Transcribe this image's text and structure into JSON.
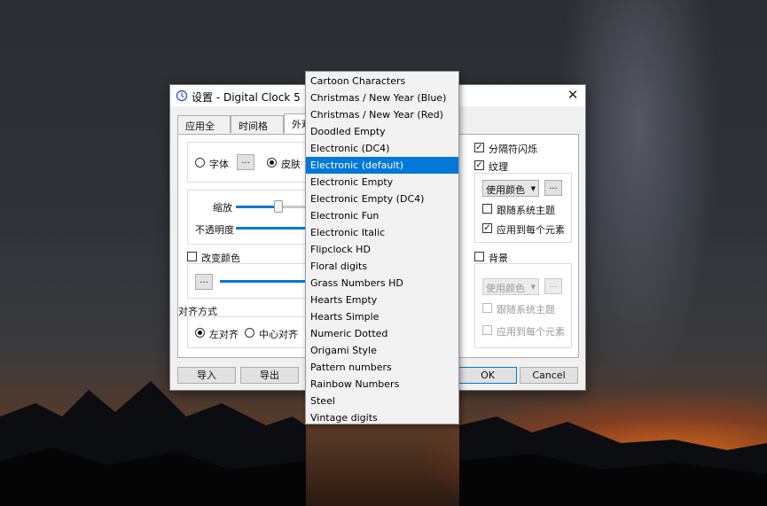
{
  "dialog": {
    "title": "设置 - Digital Clock 5",
    "tabs": [
      "应用全局",
      "时间格式",
      "外观"
    ],
    "font_label": "字体",
    "skin_label": "皮肤",
    "zoom_label": "缩放",
    "opacity_label": "不透明度",
    "change_color_label": "改变颜色",
    "align_label": "对齐方式",
    "align_left": "左对齐",
    "align_center": "中心对齐",
    "separator_blink": "分隔符闪烁",
    "texture": "纹理",
    "texture_combo": "使用颜色",
    "follow_theme": "跟随系统主题",
    "apply_each": "应用到每个元素",
    "background": "背景",
    "bg_combo": "使用颜色",
    "bg_follow_theme": "跟随系统主题",
    "bg_apply_each": "应用到每个元素",
    "import_btn": "导入",
    "export_btn": "导出",
    "ok_btn": "OK",
    "cancel_btn": "Cancel",
    "ellipsis": "..."
  },
  "skins": {
    "items": [
      "Cartoon Characters",
      "Christmas / New Year (Blue)",
      "Christmas / New Year (Red)",
      "Doodled Empty",
      "Electronic (DC4)",
      "Electronic (default)",
      "Electronic Empty",
      "Electronic Empty (DC4)",
      "Electronic Fun",
      "Electronic Italic",
      "Flipclock HD",
      "Floral digits",
      "Grass Numbers HD",
      "Hearts Empty",
      "Hearts Simple",
      "Numeric Dotted",
      "Origami Style",
      "Pattern numbers",
      "Rainbow Numbers",
      "Steel",
      "Vintage digits"
    ],
    "selected": "Electronic (default)"
  },
  "accent_color": "#0078d7",
  "checks": {
    "separator_blink": true,
    "texture": true,
    "follow_theme": false,
    "apply_each": true,
    "background": false
  }
}
